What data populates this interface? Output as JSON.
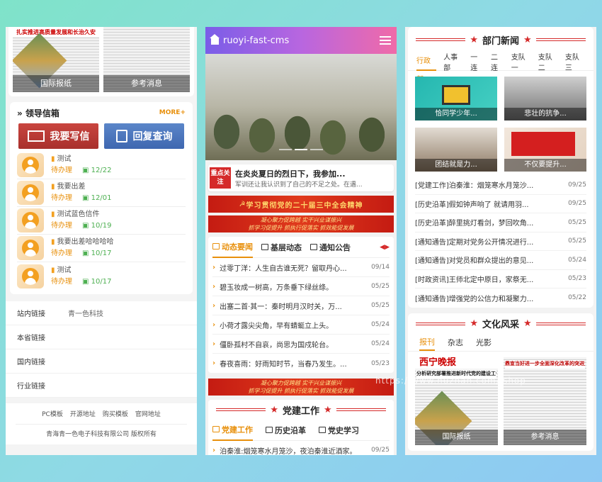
{
  "left": {
    "papers": [
      {
        "mast": "扎实推进高质量发展和长治久安",
        "caption": "国际报纸"
      },
      {
        "mast": "",
        "caption": "参考消息"
      }
    ],
    "mailbox": {
      "title": "» 领导信箱",
      "more": "MORE+",
      "write": "我要写信",
      "query": "回复查询"
    },
    "letters": [
      {
        "title": "测试",
        "status": "待办理",
        "date": "12/22"
      },
      {
        "title": "我要出差",
        "status": "待办理",
        "date": "12/01"
      },
      {
        "title": "测试蓝色信件",
        "status": "待办理",
        "date": "10/19"
      },
      {
        "title": "我要出差哈哈哈哈",
        "status": "待办理",
        "date": "10/17"
      },
      {
        "title": "测试",
        "status": "待办理",
        "date": "10/17"
      }
    ],
    "links": [
      {
        "label": "站内链接",
        "value": "青一色科技"
      },
      {
        "label": "本省链接",
        "value": ""
      },
      {
        "label": "国内链接",
        "value": ""
      },
      {
        "label": "行业链接",
        "value": ""
      }
    ],
    "footer_links": [
      "PC模板",
      "开源地址",
      "购买模板",
      "官网地址"
    ],
    "copyright": "青海青一色电子科技有限公司 版权所有"
  },
  "mid": {
    "app_title": "ruoyi-fast-cms",
    "notice": {
      "tag": "重点关注",
      "title": "在炎炎夏日的烈日下，我参加...",
      "sub": "军训还让我认识到了自己的不足之处。在遇..."
    },
    "banner1": "学习贯彻党的二十届三中全会精神",
    "banner2_top": "凝心聚力促跨越  实干兴业谋振兴",
    "banner2_bottom": "抓学习促提升  抓执行促落实  抓效能促发展",
    "tabs": [
      "动态要闻",
      "基层动态",
      "通知公告"
    ],
    "news": [
      {
        "title": "过零丁洋：人生自古谁无死？留取丹心...",
        "date": "09/14"
      },
      {
        "title": "碧玉妆成一树高，万条垂下绿丝绦。",
        "date": "05/25"
      },
      {
        "title": "出塞二首·其一：秦时明月汉时关，万...",
        "date": "05/25"
      },
      {
        "title": "小荷才露尖尖角，早有蜻蜓立上头。",
        "date": "05/24"
      },
      {
        "title": "僵卧孤村不自哀，尚思为国戍轮台。",
        "date": "05/24"
      },
      {
        "title": "春夜喜雨：好雨知时节，当春乃发生。...",
        "date": "05/23"
      }
    ],
    "party_title": "党建工作",
    "party_tabs": [
      "党建工作",
      "历史沿革",
      "党史学习"
    ],
    "party_news": [
      {
        "title": "泊秦淮:烟笼寒水月笼沙，夜泊秦淮近酒家。",
        "date": "09/25"
      }
    ]
  },
  "right": {
    "dept_title": "部门新闻",
    "dept_tabs": [
      "行政部",
      "人事部",
      "一连",
      "二连",
      "支队一",
      "支队二",
      "支队三"
    ],
    "thumbs": [
      "恰同学少年...",
      "悲壮的抗争...",
      "团结就是力...",
      "不仅要提升..."
    ],
    "news": [
      {
        "title": "[党建工作]泊秦淮：烟笼寒水月笼沙...",
        "date": "09/25"
      },
      {
        "title": "[历史沿革]假如钟声响了 就请用羽...",
        "date": "09/25"
      },
      {
        "title": "[历史沿革]醉里挑灯看剑，梦回吹角...",
        "date": "05/25"
      },
      {
        "title": "[通知通告]定期对党务公开情况进行...",
        "date": "05/25"
      },
      {
        "title": "[通知通告]对党员和群众提出的意见...",
        "date": "05/24"
      },
      {
        "title": "[时政资讯]王师北定中原日，家祭无...",
        "date": "05/23"
      },
      {
        "title": "[通知通告]增强党的公信力和凝聚力...",
        "date": "05/22"
      }
    ],
    "culture_title": "文化风采",
    "culture_tabs": [
      "报刊",
      "杂志",
      "光影"
    ],
    "papers": [
      {
        "mast": "西宁晚报",
        "headline": "分析研究部署推进新时代党的建设工作",
        "caption": "国际报纸"
      },
      {
        "mast": "",
        "headline": "鼎宣当好进一步全面深化改革的突进运实干家",
        "caption": "参考消息"
      }
    ]
  },
  "watermark": "https://www.huzhan.com/ishop"
}
